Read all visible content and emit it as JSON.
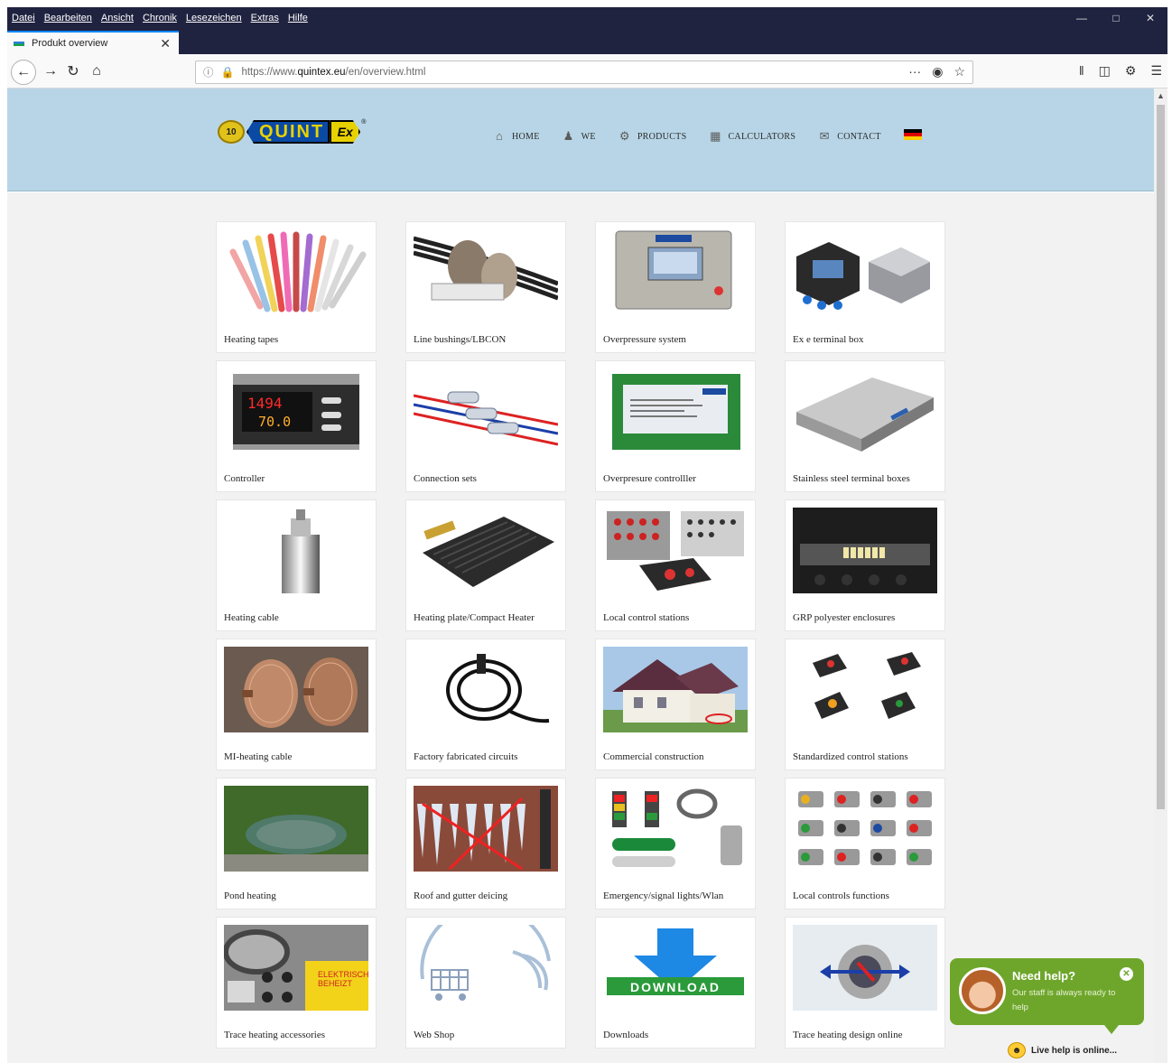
{
  "browser": {
    "menu": [
      "Datei",
      "Bearbeiten",
      "Ansicht",
      "Chronik",
      "Lesezeichen",
      "Extras",
      "Hilfe"
    ],
    "tab_title": "Produkt overview",
    "url_prefix": "https://www.",
    "url_host": "quintex.eu",
    "url_path": "/en/overview.html",
    "url_more": "···"
  },
  "logo": {
    "badge": "10",
    "word": "QUINT",
    "ex": "Ex",
    "reg": "®"
  },
  "nav": [
    {
      "label": "HOME",
      "icon": "home-icon"
    },
    {
      "label": "WE",
      "icon": "user-icon"
    },
    {
      "label": "PRODUCTS",
      "icon": "gears-icon"
    },
    {
      "label": "CALCULATORS",
      "icon": "calculator-icon"
    },
    {
      "label": "CONTACT",
      "icon": "mail-icon"
    }
  ],
  "language_flag": "flag-germany-icon",
  "products": [
    {
      "caption": "Heating tapes"
    },
    {
      "caption": "Line bushings/LBCON"
    },
    {
      "caption": "Overpressure system"
    },
    {
      "caption": "Ex e terminal box"
    },
    {
      "caption": "Controller"
    },
    {
      "caption": "Connection sets"
    },
    {
      "caption": "Overpresure controlller"
    },
    {
      "caption": "Stainless steel terminal boxes"
    },
    {
      "caption": "Heating cable"
    },
    {
      "caption": "Heating plate/Compact Heater"
    },
    {
      "caption": "Local control stations"
    },
    {
      "caption": "GRP polyester enclosures"
    },
    {
      "caption": "MI-heating cable"
    },
    {
      "caption": "Factory fabricated circuits"
    },
    {
      "caption": "Commercial construction"
    },
    {
      "caption": "Standardized control stations"
    },
    {
      "caption": "Pond heating"
    },
    {
      "caption": "Roof and gutter deicing"
    },
    {
      "caption": "Emergency/signal lights/Wlan"
    },
    {
      "caption": "Local controls functions"
    },
    {
      "caption": "Trace heating accessories"
    },
    {
      "caption": "Web Shop"
    },
    {
      "caption": "Downloads"
    },
    {
      "caption": "Trace heating design online"
    }
  ],
  "image_text": {
    "controller_display_top": "1494",
    "controller_display_bottom": "70.0",
    "download": "DOWNLOAD",
    "accessory_label_line1": "ELEKTRISCH",
    "accessory_label_line2": "BEHEIZT"
  },
  "chat": {
    "title": "Need help?",
    "subtitle": "Our staff is always ready to help",
    "online": "Live help is online..."
  }
}
